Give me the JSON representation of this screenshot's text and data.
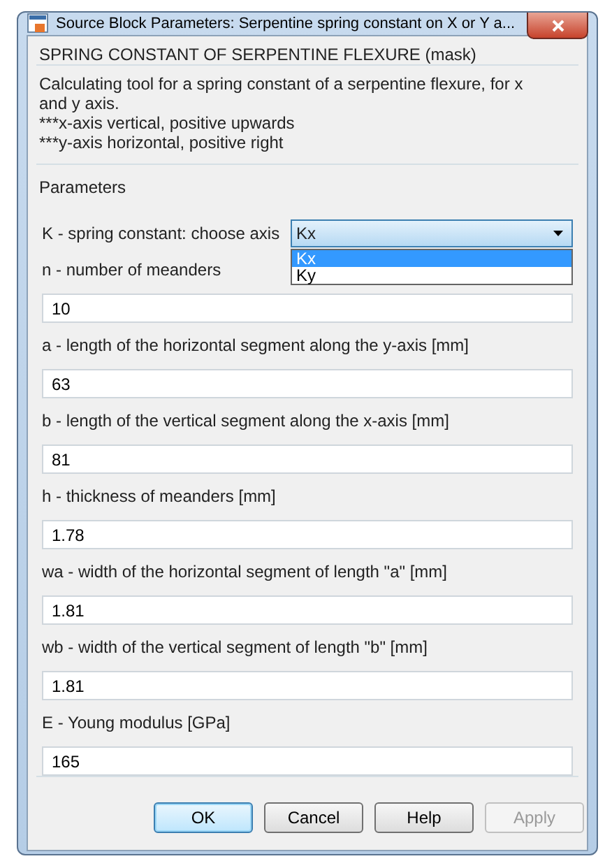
{
  "window": {
    "title": "Source Block Parameters: Serpentine spring constant on X or Y a..."
  },
  "mask": {
    "title": "SPRING CONSTANT OF SERPENTINE FLEXURE (mask)",
    "description_lines": [
      "Calculating tool for a spring constant of a serpentine flexure, for x",
      "and y axis.",
      "***x-axis vertical, positive upwards",
      "***y-axis horizontal, positive right"
    ]
  },
  "parameters": {
    "title": "Parameters",
    "fields": [
      {
        "kind": "dropdown",
        "label": "K - spring constant: choose axis",
        "value": "Kx",
        "expanded": true,
        "options": [
          {
            "label": "Kx",
            "selected": true
          },
          {
            "label": "Ky",
            "selected": false
          }
        ]
      },
      {
        "kind": "text",
        "label": "n - number of meanders",
        "value": "10"
      },
      {
        "kind": "text",
        "label": "a - length of the horizontal segment along the y-axis [mm]",
        "value": "63"
      },
      {
        "kind": "text",
        "label": "b - length of the vertical segment along the x-axis [mm]",
        "value": "81"
      },
      {
        "kind": "text",
        "label": "h - thickness of meanders [mm]",
        "value": "1.78"
      },
      {
        "kind": "text",
        "label": "wa - width of the horizontal segment of length \"a\" [mm]",
        "value": "1.81"
      },
      {
        "kind": "text",
        "label": "wb - width of the vertical segment of length \"b\" [mm]",
        "value": "1.81"
      },
      {
        "kind": "text",
        "label": "E - Young modulus [GPa]",
        "value": "165"
      }
    ]
  },
  "buttons": [
    {
      "label": "OK",
      "default": true,
      "disabled": false
    },
    {
      "label": "Cancel",
      "default": false,
      "disabled": false
    },
    {
      "label": "Help",
      "default": false,
      "disabled": false
    },
    {
      "label": "Apply",
      "default": false,
      "disabled": true
    }
  ]
}
